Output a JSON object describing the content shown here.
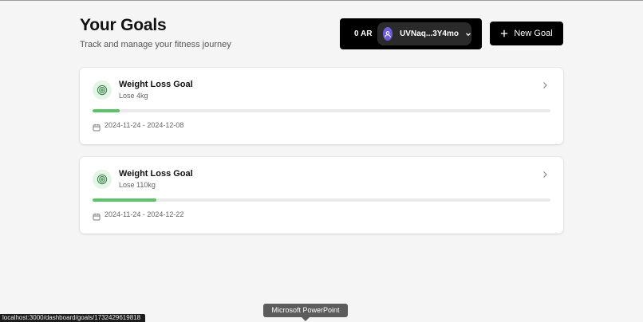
{
  "header": {
    "title": "Your Goals",
    "subtitle": "Track and manage your fitness journey"
  },
  "wallet": {
    "balance": "0 AR",
    "account": "UVNaq...3Y4mo",
    "avatar_icon": "user-icon",
    "avatar_color": "#6d5dd8"
  },
  "toolbar": {
    "new_goal_label": "New Goal"
  },
  "goals": [
    {
      "title": "Weight Loss Goal",
      "description": "Lose 4kg",
      "progress": 0.06,
      "dates": "2024-11-24 - 2024-12-08"
    },
    {
      "title": "Weight Loss Goal",
      "description": "Lose 110kg",
      "progress": 0.14,
      "dates": "2024-11-24 - 2024-12-22"
    }
  ],
  "colors": {
    "accent_green": "#5cc26a",
    "goal_icon_bg": "#e6f4e8",
    "dark": "#000000"
  },
  "status_bar": {
    "url": "localhost:3000/dashboard/goals/1732429619818"
  },
  "tooltip": {
    "text": "Microsoft PowerPoint"
  }
}
